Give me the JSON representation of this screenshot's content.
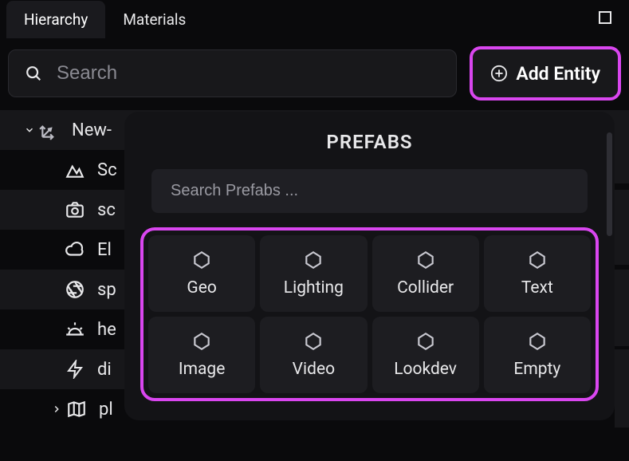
{
  "tabs": {
    "hierarchy": "Hierarchy",
    "materials": "Materials"
  },
  "search": {
    "placeholder": "Search"
  },
  "addEntity": {
    "label": "Add Entity"
  },
  "rows": {
    "r0": "New-",
    "r1": "Sc",
    "r2": "sc",
    "r3": "El",
    "r4": "sp",
    "r5": "he",
    "r6": "di",
    "r7": "pl"
  },
  "popup": {
    "title": "PREFABS",
    "searchPlaceholder": "Search Prefabs ...",
    "items": {
      "geo": "Geo",
      "lighting": "Lighting",
      "collider": "Collider",
      "text": "Text",
      "image": "Image",
      "video": "Video",
      "lookdev": "Lookdev",
      "empty": "Empty"
    }
  }
}
